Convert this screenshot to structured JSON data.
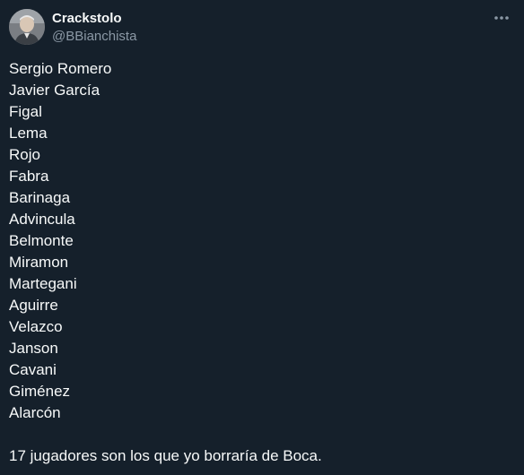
{
  "author": {
    "name": "Crackstolo",
    "handle": "@BBianchista"
  },
  "icons": {
    "avatar": "profile-photo",
    "more": "more-options-icon"
  },
  "tweet": {
    "players": [
      "Sergio Romero",
      "Javier García",
      "Figal",
      "Lema",
      "Rojo",
      "Fabra",
      "Barinaga",
      "Advincula",
      "Belmonte",
      "Miramon",
      "Martegani",
      "Aguirre",
      "Velazco",
      "Janson",
      "Cavani",
      "Giménez",
      "Alarcón"
    ],
    "closing": "17 jugadores son los que yo borraría de Boca."
  },
  "colors": {
    "background": "#15202b",
    "text": "#f7f9f9",
    "secondary": "#8b98a5"
  }
}
